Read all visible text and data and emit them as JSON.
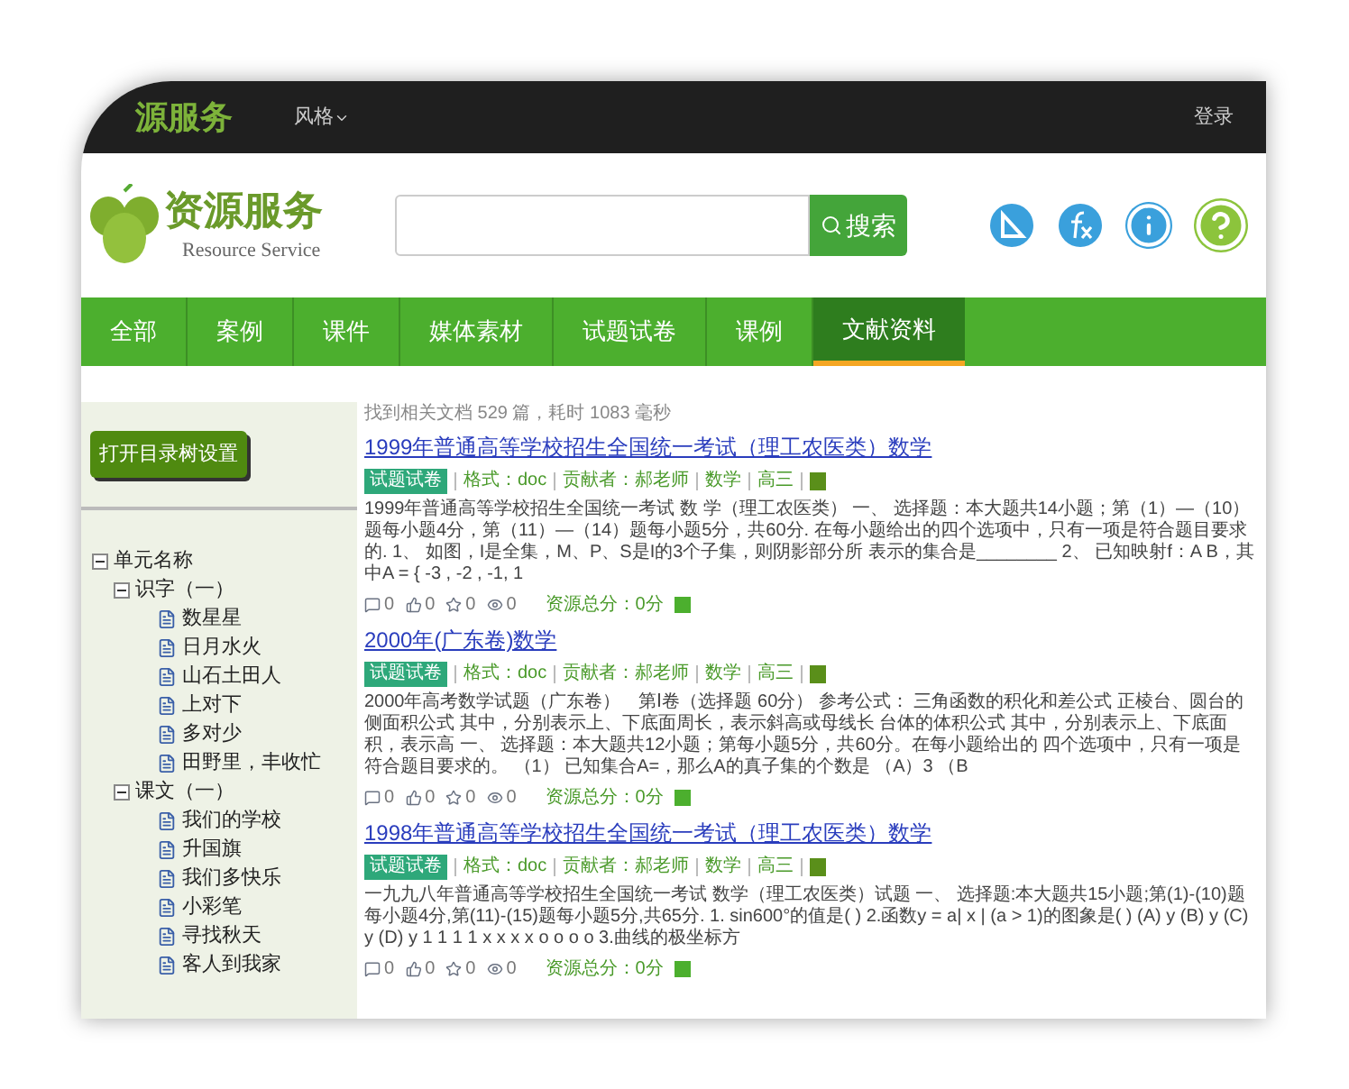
{
  "top_bar": {
    "brand": "源服务",
    "style_menu": "风格",
    "login": "登录"
  },
  "header": {
    "logo_title": "资源服务",
    "logo_subtitle": "Resource Service",
    "search": {
      "button": "搜索"
    }
  },
  "nav": [
    {
      "label": "全部",
      "selected": false
    },
    {
      "label": "案例",
      "selected": false
    },
    {
      "label": "课件",
      "selected": false
    },
    {
      "label": "媒体素材",
      "selected": false
    },
    {
      "label": "试题试卷",
      "selected": false
    },
    {
      "label": "课例",
      "selected": false
    },
    {
      "label": "文献资料",
      "selected": true
    }
  ],
  "sidebar": {
    "button": "打开目录树设置",
    "tree": [
      {
        "label": "单元名称",
        "expanded": true,
        "children": [
          {
            "label": "识字（一）",
            "expanded": true,
            "children": [
              {
                "label": "数星星"
              },
              {
                "label": "日月水火"
              },
              {
                "label": "山石土田人"
              },
              {
                "label": "上对下"
              },
              {
                "label": "多对少"
              },
              {
                "label": "田野里，丰收忙"
              }
            ]
          },
          {
            "label": "课文（一）",
            "expanded": true,
            "children": [
              {
                "label": "我们的学校"
              },
              {
                "label": "升国旗"
              },
              {
                "label": "我们多快乐"
              },
              {
                "label": "小彩笔"
              },
              {
                "label": "寻找秋天"
              },
              {
                "label": "客人到我家"
              }
            ]
          }
        ]
      }
    ]
  },
  "results": {
    "summary": "找到相关文档 529 篇，耗时 1083 毫秒",
    "items": [
      {
        "title": "1999年普通高等学校招生全国统一考试（理工农医类）数学",
        "tag": "试题试卷",
        "meta": [
          "格式：doc",
          "贡献者：郝老师",
          "数学",
          "高三"
        ],
        "snippet": "1999年普通高等学校招生全国统一考试 数 学（理工农医类） 一、 选择题：本大题共14小题；第（1）—（10）题每小题4分，第（11）—（14）题每小题5分，共60分. 在每小题给出的四个选项中，只有一项是符合题目要求的. 1、 如图，I是全集，M、P、S是I的3个子集，则阴影部分所 表示的集合是________ 2、 已知映射f：A B，其中A = { -3 , -2 , -1, 1",
        "stats": [
          {
            "kind": "comment",
            "count": "0"
          },
          {
            "kind": "like",
            "count": "0"
          },
          {
            "kind": "star",
            "count": "0"
          },
          {
            "kind": "view",
            "count": "0"
          }
        ],
        "score": "资源总分：0分"
      },
      {
        "title": "2000年(广东卷)数学",
        "tag": "试题试卷",
        "meta": [
          "格式：doc",
          "贡献者：郝老师",
          "数学",
          "高三"
        ],
        "snippet": "2000年高考数学试题（广东卷）　第Ⅰ卷（选择题 60分） 参考公式： 三角函数的积化和差公式 正棱台、圆台的侧面积公式 其中，分别表示上、下底面周长，表示斜高或母线长 台体的体积公式 其中，分别表示上、下底面积，表示高 一、 选择题：本大题共12小题；第每小题5分，共60分。在每小题给出的 四个选项中，只有一项是符合题目要求的。 （1） 已知集合A=，那么A的真子集的个数是 （A）3 （B",
        "stats": [
          {
            "kind": "comment",
            "count": "0"
          },
          {
            "kind": "like",
            "count": "0"
          },
          {
            "kind": "star",
            "count": "0"
          },
          {
            "kind": "view",
            "count": "0"
          }
        ],
        "score": "资源总分：0分"
      },
      {
        "title": "1998年普通高等学校招生全国统一考试（理工农医类）数学",
        "tag": "试题试卷",
        "meta": [
          "格式：doc",
          "贡献者：郝老师",
          "数学",
          "高三"
        ],
        "snippet": "一九九八年普通高等学校招生全国统一考试 数学（理工农医类）试题 一、 选择题:本大题共15小题;第(1)-(10)题每小题4分,第(11)-(15)题每小题5分,共65分. 1. sin600°的值是( ) 2.函数y = a| x | (a > 1)的图象是( ) (A) y (B) y (C) y (D) y 1 1 1 1 x x x x o o o o 3.曲线的极坐标方",
        "stats": [
          {
            "kind": "comment",
            "count": "0"
          },
          {
            "kind": "like",
            "count": "0"
          },
          {
            "kind": "star",
            "count": "0"
          },
          {
            "kind": "view",
            "count": "0"
          }
        ],
        "score": "资源总分：0分"
      }
    ]
  }
}
